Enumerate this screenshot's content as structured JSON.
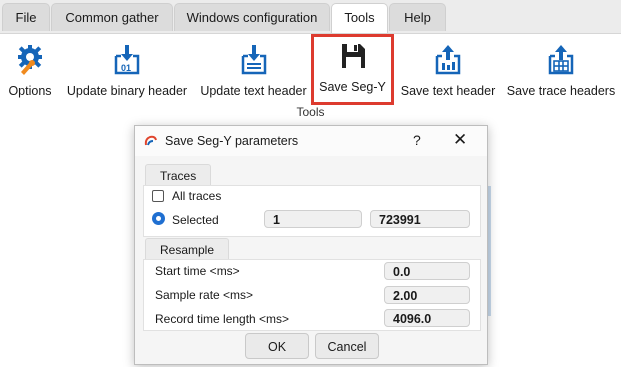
{
  "menu_tabs": [
    {
      "label": "File",
      "active": false
    },
    {
      "label": "Common gather",
      "active": false
    },
    {
      "label": "Windows configuration",
      "active": false
    },
    {
      "label": "Tools",
      "active": true
    },
    {
      "label": "Help",
      "active": false
    }
  ],
  "ribbon": {
    "buttons": [
      {
        "label": "Options",
        "icon": "gear-wrench-icon"
      },
      {
        "label": "Update binary header",
        "icon": "binary-update-icon"
      },
      {
        "label": "Update text header",
        "icon": "text-update-icon"
      },
      {
        "label": "Save Seg-Y",
        "icon": "floppy-disk-icon",
        "selected": true
      },
      {
        "label": "Save text header",
        "icon": "save-text-icon"
      },
      {
        "label": "Save trace headers",
        "icon": "save-table-icon"
      }
    ],
    "group_label": "Tools"
  },
  "dialog": {
    "title": "Save Seg-Y parameters",
    "help": "?",
    "close": "✕",
    "traces": {
      "header": "Traces",
      "all_label": "All traces",
      "all_checked": false,
      "selected_label": "Selected",
      "selected_checked": true,
      "from": "1",
      "to": "723991"
    },
    "resample": {
      "header": "Resample",
      "start_time_label": "Start time <ms>",
      "start_time": "0.0",
      "sample_rate_label": "Sample rate <ms>",
      "sample_rate": "2.00",
      "record_length_label": "Record time length <ms>",
      "record_length": "4096.0"
    },
    "ok": "OK",
    "cancel": "Cancel"
  },
  "colors": {
    "accent": "#1f6fd1",
    "icon_blue": "#1565b8",
    "highlight": "#dd3b2f",
    "gear_orange": "#f08a1e"
  }
}
